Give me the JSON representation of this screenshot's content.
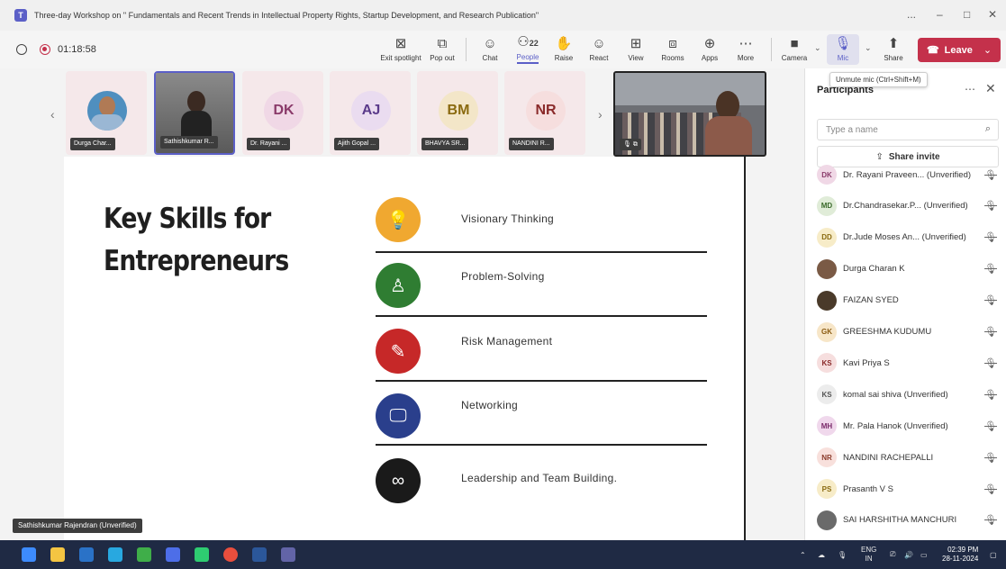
{
  "window": {
    "title": "Three-day Workshop on \" Fundamentals and Recent Trends in Intellectual Property Rights, Startup Development, and Research Publication\"",
    "controls": [
      "...",
      "–",
      "□",
      "✕"
    ]
  },
  "toolbar": {
    "timer": "01:18:58",
    "buttons": {
      "exit_spotlight": "Exit spotlight",
      "pop_out": "Pop out",
      "chat": "Chat",
      "people": "People",
      "people_count": "22",
      "raise": "Raise",
      "react": "React",
      "view": "View",
      "rooms": "Rooms",
      "apps": "Apps",
      "more": "More",
      "camera": "Camera",
      "mic": "Mic",
      "share": "Share",
      "leave": "Leave"
    },
    "mic_tooltip": "Unmute mic (Ctrl+Shift+M)"
  },
  "strip": {
    "tiles": [
      {
        "name": "Durga Char...",
        "initials": "",
        "color": "#f5e8ea"
      },
      {
        "name": "Sathishkumar R...",
        "initials": "",
        "color": "#cfcfcf"
      },
      {
        "name": "Dr. Rayani ...",
        "initials": "DK",
        "color": "#f0d8e6"
      },
      {
        "name": "Ajith Gopal ...",
        "initials": "AJ",
        "color": "#eadcf0"
      },
      {
        "name": "BHAVYA SR...",
        "initials": "BM",
        "color": "#f3e6c8"
      },
      {
        "name": "NANDINI R...",
        "initials": "NR",
        "color": "#f6dede"
      }
    ]
  },
  "slide": {
    "title_line1": "Key Skills for",
    "title_line2": "Entrepreneurs",
    "skills": [
      {
        "label": "Visionary Thinking",
        "icon": "lightbulb-icon",
        "color": "#f0a830"
      },
      {
        "label": "Problem-Solving",
        "icon": "bell-icon",
        "color": "#2f7d32"
      },
      {
        "label": "Risk Management",
        "icon": "pencil-icon",
        "color": "#c62828"
      },
      {
        "label": "Networking",
        "icon": "monitor-icon",
        "color": "#2a3f8c"
      },
      {
        "label": "Leadership and Team Building.",
        "icon": "glasses-icon",
        "color": "#1a1a1a"
      }
    ]
  },
  "presenter_tag": "Sathishkumar Rajendran (Unverified)",
  "participants": {
    "title": "Participants",
    "search_placeholder": "Type a name",
    "share_invite": "Share invite",
    "list": [
      {
        "initials": "DK",
        "name": "Dr. Rayani Praveen... (Unverified)",
        "color": "#f0d8e6",
        "fg": "#8a3a6a"
      },
      {
        "initials": "MD",
        "name": "Dr.Chandrasekar.P... (Unverified)",
        "color": "#e0ecd8",
        "fg": "#3a6a2a"
      },
      {
        "initials": "DD",
        "name": "Dr.Jude Moses An... (Unverified)",
        "color": "#f7ecc8",
        "fg": "#8a6a10"
      },
      {
        "initials": "",
        "name": "Durga Charan K",
        "color": "#7a5a45",
        "fg": "#ffffff"
      },
      {
        "initials": "",
        "name": "FAIZAN SYED",
        "color": "#4a3a2a",
        "fg": "#ffffff"
      },
      {
        "initials": "GK",
        "name": "GREESHMA KUDUMU",
        "color": "#f7e6c8",
        "fg": "#8a5a10"
      },
      {
        "initials": "KS",
        "name": "Kavi Priya S",
        "color": "#f6dede",
        "fg": "#8a2a2a"
      },
      {
        "initials": "KS",
        "name": "komal sai shiva (Unverified)",
        "color": "#ececec",
        "fg": "#555555"
      },
      {
        "initials": "MH",
        "name": "Mr. Pala Hanok (Unverified)",
        "color": "#f0d8ec",
        "fg": "#7a2a6a"
      },
      {
        "initials": "NR",
        "name": "NANDINI RACHEPALLI",
        "color": "#f8e0dc",
        "fg": "#8a3a2a"
      },
      {
        "initials": "PS",
        "name": "Prasanth V S",
        "color": "#f7ecc8",
        "fg": "#8a6a10"
      },
      {
        "initials": "",
        "name": "SAI HARSHITHA MANCHURI",
        "color": "#6a6a6a",
        "fg": "#ffffff"
      }
    ]
  },
  "taskbar": {
    "lang": "ENG",
    "region": "IN",
    "time": "02:39 PM",
    "date": "28-11-2024"
  }
}
